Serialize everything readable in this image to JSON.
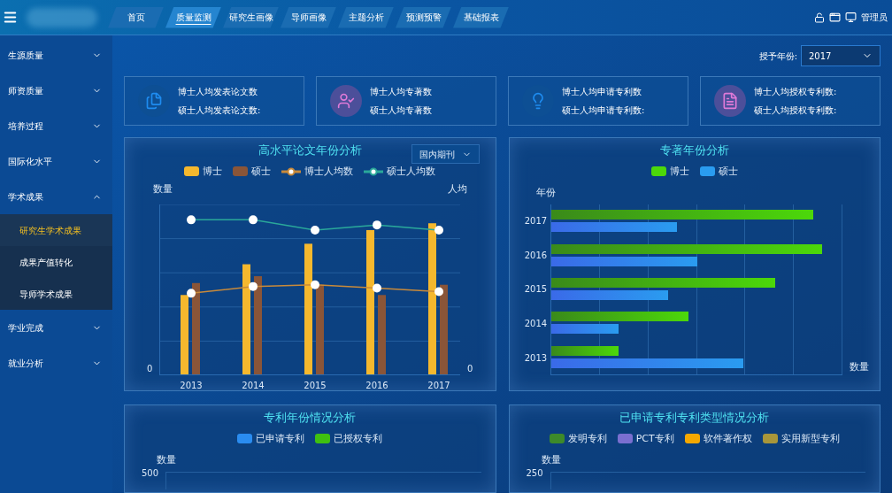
{
  "header": {
    "tabs": [
      {
        "label": "首页",
        "selected": false
      },
      {
        "label": "质量监测",
        "selected": true
      },
      {
        "label": "研究生画像",
        "selected": false
      },
      {
        "label": "导师画像",
        "selected": false
      },
      {
        "label": "主题分析",
        "selected": false
      },
      {
        "label": "预测预警",
        "selected": false
      },
      {
        "label": "基础报表",
        "selected": false
      }
    ],
    "user": "管理员"
  },
  "sidebar": {
    "items": [
      {
        "label": "生源质量",
        "expanded": false
      },
      {
        "label": "师资质量",
        "expanded": false
      },
      {
        "label": "培养过程",
        "expanded": false
      },
      {
        "label": "国际化水平",
        "expanded": false
      },
      {
        "label": "学术成果",
        "expanded": true,
        "children": [
          {
            "label": "研究生学术成果",
            "selected": true
          },
          {
            "label": "成果产值转化",
            "selected": false
          },
          {
            "label": "导师学术成果",
            "selected": false
          }
        ]
      },
      {
        "label": "学业完成",
        "expanded": false
      },
      {
        "label": "就业分析",
        "expanded": false
      }
    ]
  },
  "filter": {
    "label": "授予年份:",
    "value": "2017"
  },
  "stat_cards": [
    {
      "kind": "papers",
      "lines": [
        "博士人均发表论文数",
        "硕士人均发表论文数:"
      ]
    },
    {
      "kind": "books",
      "lines": [
        "博士人均专著数",
        "硕士人均专著数"
      ]
    },
    {
      "kind": "applied",
      "lines": [
        "博士人均申请专利数",
        "硕士人均申请专利数:"
      ]
    },
    {
      "kind": "granted",
      "lines": [
        "博士人均授权专利数:",
        "硕士人均授权专利数:"
      ]
    }
  ],
  "panels": [
    {
      "kind": "paper_chart",
      "title": "高水平论文年份分析",
      "dropdown": "国内期刊",
      "legend": [
        {
          "label": "博士",
          "kind": "bar",
          "color": "#f5b82e"
        },
        {
          "label": "硕士",
          "kind": "bar",
          "color": "#8a5538"
        },
        {
          "label": "博士人均数",
          "kind": "line",
          "color": "#c98a3a"
        },
        {
          "label": "硕士人均数",
          "kind": "line",
          "color": "#2aa89a"
        }
      ],
      "ylabel": "数量",
      "y2label": "人均",
      "ytick": "0",
      "y2tick": "0",
      "categories": [
        "2013",
        "2014",
        "2015",
        "2016",
        "2017"
      ]
    },
    {
      "kind": "book_chart",
      "title": "专著年份分析",
      "legend": [
        {
          "label": "博士",
          "kind": "bar",
          "color": "#4cd80a"
        },
        {
          "label": "硕士",
          "kind": "bar",
          "color": "#2a9cf0"
        }
      ],
      "ylabel": "年份",
      "xlabel": "数量",
      "categories": [
        "2017",
        "2016",
        "2015",
        "2014",
        "2013"
      ]
    },
    {
      "kind": "stub",
      "title": "专利年份情况分析",
      "legend": [
        {
          "label": "已申请专利",
          "kind": "bar",
          "color": "#2a8cf0"
        },
        {
          "label": "已授权专利",
          "kind": "bar",
          "color": "#3fc010"
        }
      ],
      "ylabel": "数量",
      "ytick": "500"
    },
    {
      "kind": "stub",
      "title": "已申请专利专利类型情况分析",
      "legend": [
        {
          "label": "发明专利",
          "kind": "bar",
          "color": "#3d8a2a"
        },
        {
          "label": "PCT专利",
          "kind": "bar",
          "color": "#7a6fd0"
        },
        {
          "label": "软件著作权",
          "kind": "bar",
          "color": "#f5a800"
        },
        {
          "label": "实用新型专利",
          "kind": "bar",
          "color": "#a8963a"
        }
      ],
      "ylabel": "数量",
      "ytick": "250"
    }
  ]
}
